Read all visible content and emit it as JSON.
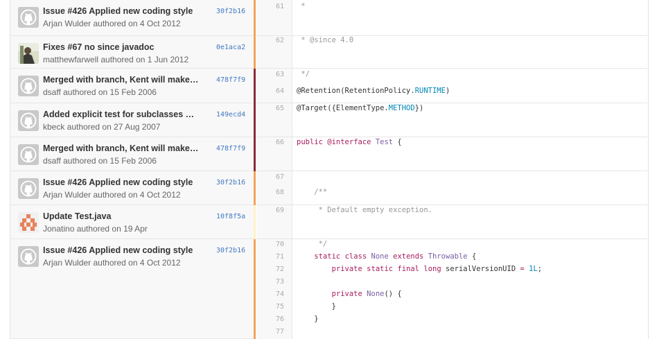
{
  "colors": {
    "age_bars": [
      "#f3a35b",
      "#f3a35b",
      "#8a2a3a",
      "#8a2a3a",
      "#8a2a3a",
      "#f3a35b",
      "#fff1c9",
      "#f3a35b"
    ],
    "sha_link": "#4078c0"
  },
  "blame": [
    {
      "title": "Issue #426 Applied new coding style",
      "meta": "Arjan Wulder authored on 4 Oct 2012",
      "sha": "30f2b16",
      "avatar": "github-octocat-icon"
    },
    {
      "title": "Fixes #67 no since javadoc",
      "meta": "matthewfarwell authored on 1 Jun 2012",
      "sha": "0e1aca2",
      "avatar": "user-photo-avatar"
    },
    {
      "title": "Merged with branch, Kent will make…",
      "meta": "dsaff authored on 15 Feb 2006",
      "sha": "478f7f9",
      "avatar": "github-octocat-icon"
    },
    {
      "title": "Added explicit test for subclasses …",
      "meta": "kbeck authored on 27 Aug 2007",
      "sha": "149ecd4",
      "avatar": "github-octocat-icon"
    },
    {
      "title": "Merged with branch, Kent will make…",
      "meta": "dsaff authored on 15 Feb 2006",
      "sha": "478f7f9",
      "avatar": "github-octocat-icon"
    },
    {
      "title": "Issue #426 Applied new coding style",
      "meta": "Arjan Wulder authored on 4 Oct 2012",
      "sha": "30f2b16",
      "avatar": "github-octocat-icon"
    },
    {
      "title": "Update Test.java",
      "meta": "Jonatino authored on 19 Apr",
      "sha": "10f8f5a",
      "avatar": "identicon-avatar"
    },
    {
      "title": "Issue #426 Applied new coding style",
      "meta": "Arjan Wulder authored on 4 Oct 2012",
      "sha": "30f2b16",
      "avatar": "github-octocat-icon"
    }
  ],
  "lines": [
    {
      "n": "61",
      "tokens": [
        {
          "c": "c-cmt",
          "t": " *"
        }
      ]
    },
    {
      "n": "62",
      "tokens": [
        {
          "c": "c-cmt",
          "t": " * @since 4.0"
        }
      ]
    },
    {
      "n": "63",
      "tokens": [
        {
          "c": "c-cmt",
          "t": " */"
        }
      ]
    },
    {
      "n": "64",
      "tokens": [
        {
          "c": "",
          "t": "@Retention(RetentionPolicy."
        },
        {
          "c": "c-cn",
          "t": "RUNTIME"
        },
        {
          "c": "",
          "t": ")"
        }
      ]
    },
    {
      "n": "65",
      "tokens": [
        {
          "c": "",
          "t": "@Target({ElementType."
        },
        {
          "c": "c-cn",
          "t": "METHOD"
        },
        {
          "c": "",
          "t": "})"
        }
      ]
    },
    {
      "n": "66",
      "tokens": [
        {
          "c": "c-kw",
          "t": "public"
        },
        {
          "c": "",
          "t": " "
        },
        {
          "c": "c-kw",
          "t": "@interface"
        },
        {
          "c": "",
          "t": " "
        },
        {
          "c": "c-ty",
          "t": "Test"
        },
        {
          "c": "",
          "t": " {"
        }
      ]
    },
    {
      "n": "67",
      "tokens": []
    },
    {
      "n": "68",
      "tokens": [
        {
          "c": "c-cmt",
          "t": "    /**"
        }
      ]
    },
    {
      "n": "69",
      "tokens": [
        {
          "c": "c-cmt",
          "t": "     * Default empty exception."
        }
      ]
    },
    {
      "n": "70",
      "tokens": [
        {
          "c": "c-cmt",
          "t": "     */"
        }
      ]
    },
    {
      "n": "71",
      "tokens": [
        {
          "c": "",
          "t": "    "
        },
        {
          "c": "c-kw",
          "t": "static"
        },
        {
          "c": "",
          "t": " "
        },
        {
          "c": "c-kw",
          "t": "class"
        },
        {
          "c": "",
          "t": " "
        },
        {
          "c": "c-ty",
          "t": "None"
        },
        {
          "c": "",
          "t": " "
        },
        {
          "c": "c-kw",
          "t": "extends"
        },
        {
          "c": "",
          "t": " "
        },
        {
          "c": "c-ty",
          "t": "Throwable"
        },
        {
          "c": "",
          "t": " {"
        }
      ]
    },
    {
      "n": "72",
      "tokens": [
        {
          "c": "",
          "t": "        "
        },
        {
          "c": "c-kw",
          "t": "private"
        },
        {
          "c": "",
          "t": " "
        },
        {
          "c": "c-kw",
          "t": "static"
        },
        {
          "c": "",
          "t": " "
        },
        {
          "c": "c-kw",
          "t": "final"
        },
        {
          "c": "",
          "t": " "
        },
        {
          "c": "c-kw",
          "t": "long"
        },
        {
          "c": "",
          "t": " serialVersionUID "
        },
        {
          "c": "c-kw",
          "t": "="
        },
        {
          "c": "",
          "t": " "
        },
        {
          "c": "c-cn",
          "t": "1L"
        },
        {
          "c": "",
          "t": ";"
        }
      ]
    },
    {
      "n": "73",
      "tokens": []
    },
    {
      "n": "74",
      "tokens": [
        {
          "c": "",
          "t": "        "
        },
        {
          "c": "c-kw",
          "t": "private"
        },
        {
          "c": "",
          "t": " "
        },
        {
          "c": "c-ty",
          "t": "None"
        },
        {
          "c": "",
          "t": "() {"
        }
      ]
    },
    {
      "n": "75",
      "tokens": [
        {
          "c": "",
          "t": "        }"
        }
      ]
    },
    {
      "n": "76",
      "tokens": [
        {
          "c": "",
          "t": "    }"
        }
      ]
    },
    {
      "n": "77",
      "tokens": []
    }
  ]
}
